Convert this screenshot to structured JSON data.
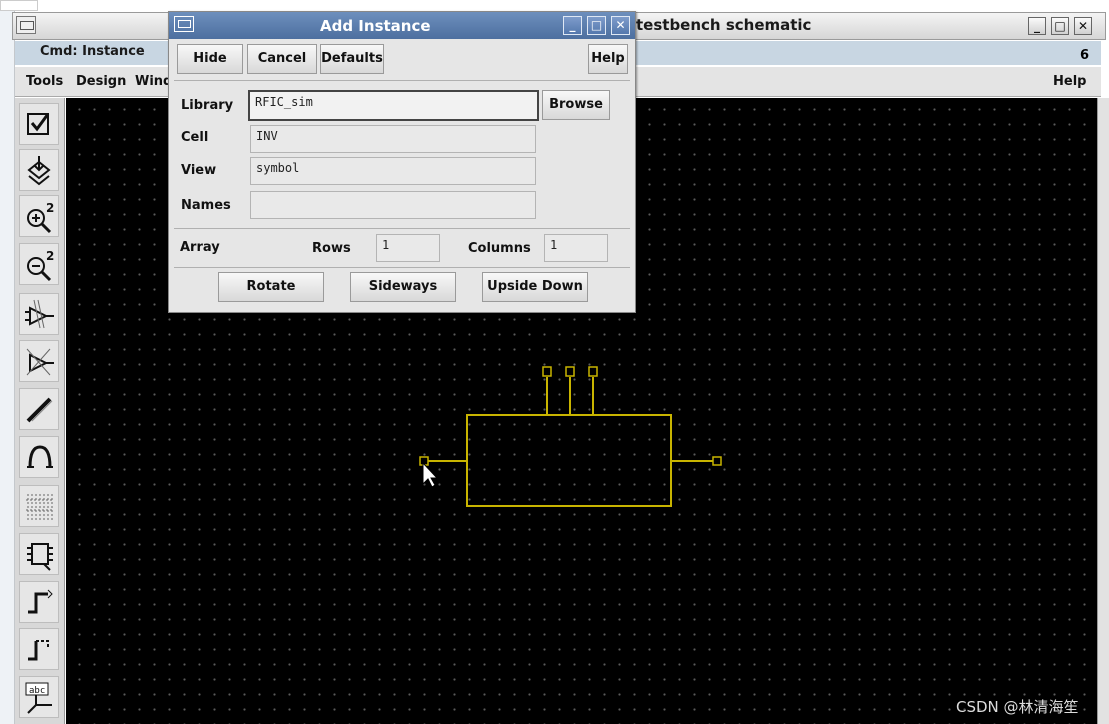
{
  "main_window": {
    "title": "testbench schematic",
    "cmd": "Cmd: Instance",
    "cmd_number": "6",
    "menus": [
      "Tools",
      "Design",
      "Wind",
      "Help"
    ],
    "window_buttons": [
      "_",
      "□",
      "✕"
    ]
  },
  "dialog": {
    "title": "Add Instance",
    "window_buttons": [
      "_",
      "□",
      "✕"
    ],
    "buttons": {
      "hide": "Hide",
      "cancel": "Cancel",
      "defaults": "Defaults",
      "help": "Help",
      "browse": "Browse"
    },
    "fields": {
      "library_label": "Library",
      "library_value": "RFIC_sim",
      "cell_label": "Cell",
      "cell_value": "INV",
      "view_label": "View",
      "view_value": "symbol",
      "names_label": "Names",
      "names_value": ""
    },
    "array": {
      "label": "Array",
      "rows_label": "Rows",
      "rows_value": "1",
      "columns_label": "Columns",
      "columns_value": "1"
    },
    "transform_buttons": {
      "rotate": "Rotate",
      "sideways": "Sideways",
      "upside_down": "Upside Down"
    }
  },
  "toolbar": {
    "icons": [
      "check-icon",
      "descend-icon",
      "zoom-in-icon",
      "zoom-out-icon",
      "instance-icon",
      "pin-icon",
      "wire-icon",
      "arc-icon",
      "pattern-icon",
      "chip-icon",
      "step-wire-icon",
      "dashed-wire-icon",
      "label-icon"
    ],
    "zoom_in_label": "2",
    "zoom_out_label": "2",
    "label_icon_text": "abc"
  },
  "colors": {
    "symbol": "#c8b400",
    "canvas": "#000000",
    "dialog_title": "#5b7db0"
  },
  "watermark": "CSDN @林清海笙"
}
